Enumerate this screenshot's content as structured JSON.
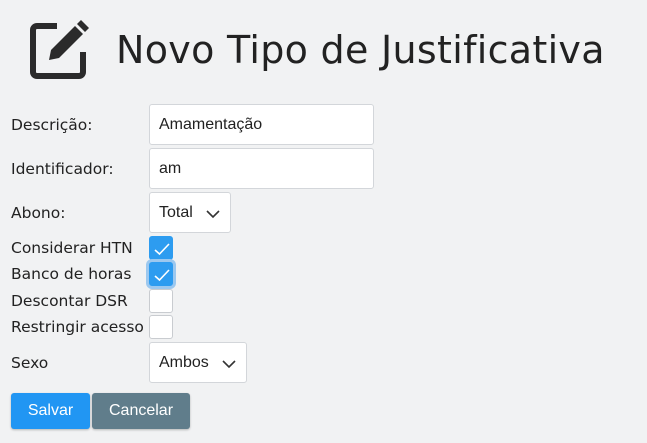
{
  "header": {
    "icon": "edit-icon",
    "title": "Novo Tipo de Justificativa"
  },
  "form": {
    "descricao": {
      "label": "Descrição:",
      "value": "Amamentação"
    },
    "identificador": {
      "label": "Identificador:",
      "value": "am"
    },
    "abono": {
      "label": "Abono:",
      "selected": "Total"
    },
    "considerar_htn": {
      "label": "Considerar HTN",
      "checked": true
    },
    "banco_de_horas": {
      "label": "Banco de horas",
      "checked": true
    },
    "descontar_dsr": {
      "label": "Descontar DSR",
      "checked": false
    },
    "restringir_acesso": {
      "label": "Restringir acesso",
      "checked": false
    },
    "sexo": {
      "label": "Sexo",
      "selected": "Ambos"
    }
  },
  "actions": {
    "save_label": "Salvar",
    "cancel_label": "Cancelar"
  },
  "colors": {
    "primary": "#2196f3",
    "secondary": "#607d8b",
    "checkbox_checked": "#2d9cf0",
    "background": "#f1f2f3"
  }
}
